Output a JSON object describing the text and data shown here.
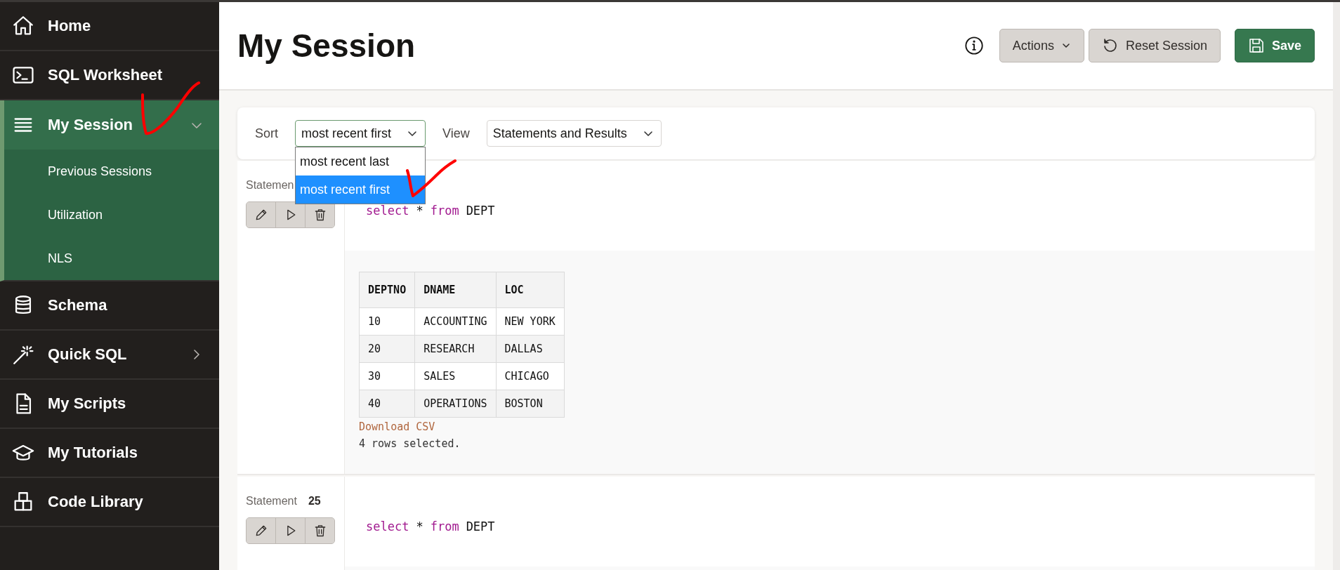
{
  "sidebar": {
    "items": [
      {
        "label": "Home",
        "selected": false
      },
      {
        "label": "SQL Worksheet",
        "selected": false
      },
      {
        "label": "My Session",
        "selected": true,
        "expanded": true,
        "children": [
          {
            "label": "Previous Sessions"
          },
          {
            "label": "Utilization"
          },
          {
            "label": "NLS"
          }
        ]
      },
      {
        "label": "Schema",
        "selected": false
      },
      {
        "label": "Quick SQL",
        "selected": false,
        "expanded": false
      },
      {
        "label": "My Scripts",
        "selected": false
      },
      {
        "label": "My Tutorials",
        "selected": false
      },
      {
        "label": "Code Library",
        "selected": false
      }
    ]
  },
  "header": {
    "title": "My Session",
    "buttons": [
      {
        "label": "Actions",
        "kind": "menu"
      },
      {
        "label": "Reset Session",
        "kind": "reset"
      },
      {
        "label": "Save",
        "kind": "primary"
      }
    ]
  },
  "toolbar": {
    "sort": {
      "label": "Sort",
      "value": "most recent first",
      "open": true,
      "options": [
        {
          "label": "most recent last",
          "selected": false
        },
        {
          "label": "most recent first",
          "selected": true
        }
      ]
    },
    "view": {
      "label": "View",
      "value": "Statements and Results",
      "open": false
    }
  },
  "statements": [
    {
      "label": "Statemen",
      "code": [
        {
          "text": "select",
          "kind": "keyword"
        },
        {
          "text": "*",
          "kind": "plain"
        },
        {
          "text": "from",
          "kind": "keyword"
        },
        {
          "text": "DEPT",
          "kind": "plain"
        }
      ],
      "result": {
        "columns": [
          "DEPTNO",
          "DNAME",
          "LOC"
        ],
        "rows": [
          [
            "10",
            "ACCOUNTING",
            "NEW YORK"
          ],
          [
            "20",
            "RESEARCH",
            "DALLAS"
          ],
          [
            "30",
            "SALES",
            "CHICAGO"
          ],
          [
            "40",
            "OPERATIONS",
            "BOSTON"
          ]
        ],
        "download": "Download CSV",
        "message": "4 rows selected."
      }
    },
    {
      "label": "Statement",
      "number": "25",
      "code": [
        {
          "text": "select",
          "kind": "keyword"
        },
        {
          "text": "*",
          "kind": "plain"
        },
        {
          "text": "from",
          "kind": "keyword"
        },
        {
          "text": "DEPT",
          "kind": "plain"
        }
      ]
    }
  ]
}
